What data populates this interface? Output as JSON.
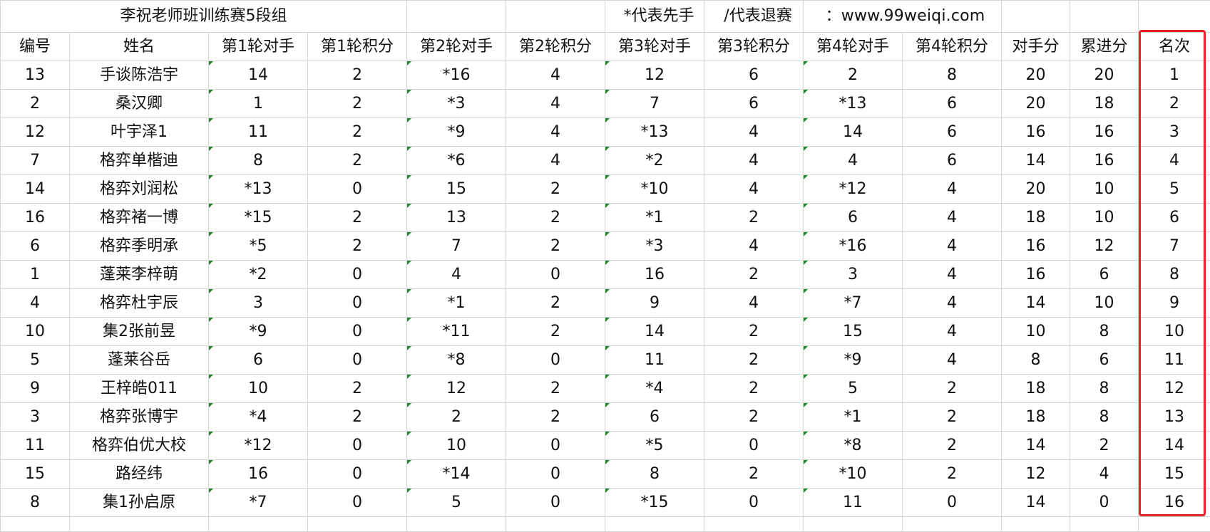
{
  "header": {
    "title": "李祝老师班训练赛5段组",
    "note_first_move": "*代表先手",
    "note_withdraw": "/代表退赛",
    "site": "：www.99weiqi.com"
  },
  "columns": [
    "编号",
    "姓名",
    "第1轮对手",
    "第1轮积分",
    "第2轮对手",
    "第2轮积分",
    "第3轮对手",
    "第3轮积分",
    "第4轮对手",
    "第4轮积分",
    "对手分",
    "累进分",
    "名次"
  ],
  "rows": [
    [
      "13",
      "手谈陈浩宇",
      "14",
      "2",
      "*16",
      "4",
      "12",
      "6",
      "2",
      "8",
      "20",
      "20",
      "1"
    ],
    [
      "2",
      "桑汉卿",
      "1",
      "2",
      "*3",
      "4",
      "7",
      "6",
      "*13",
      "6",
      "20",
      "18",
      "2"
    ],
    [
      "12",
      "叶宇泽1",
      "11",
      "2",
      "*9",
      "4",
      "*13",
      "4",
      "14",
      "6",
      "16",
      "16",
      "3"
    ],
    [
      "7",
      "格弈单楷迪",
      "8",
      "2",
      "*6",
      "4",
      "*2",
      "4",
      "4",
      "6",
      "14",
      "16",
      "4"
    ],
    [
      "14",
      "格弈刘润松",
      "*13",
      "0",
      "15",
      "2",
      "*10",
      "4",
      "*12",
      "4",
      "20",
      "10",
      "5"
    ],
    [
      "16",
      "格弈褚一博",
      "*15",
      "2",
      "13",
      "2",
      "*1",
      "2",
      "6",
      "4",
      "18",
      "10",
      "6"
    ],
    [
      "6",
      "格弈季明承",
      "*5",
      "2",
      "7",
      "2",
      "*3",
      "4",
      "*16",
      "4",
      "16",
      "12",
      "7"
    ],
    [
      "1",
      "蓬莱李梓萌",
      "*2",
      "0",
      "4",
      "0",
      "16",
      "2",
      "3",
      "4",
      "16",
      "6",
      "8"
    ],
    [
      "4",
      "格弈杜宇辰",
      "3",
      "0",
      "*1",
      "2",
      "9",
      "4",
      "*7",
      "4",
      "14",
      "10",
      "9"
    ],
    [
      "10",
      "集2张前昱",
      "*9",
      "0",
      "*11",
      "2",
      "14",
      "2",
      "15",
      "4",
      "10",
      "8",
      "10"
    ],
    [
      "5",
      "蓬莱谷岳",
      "6",
      "0",
      "*8",
      "0",
      "11",
      "2",
      "*9",
      "4",
      "8",
      "6",
      "11"
    ],
    [
      "9",
      "王梓皓011",
      "10",
      "2",
      "12",
      "2",
      "*4",
      "2",
      "5",
      "2",
      "18",
      "8",
      "12"
    ],
    [
      "3",
      "格弈张博宇",
      "*4",
      "2",
      "2",
      "2",
      "6",
      "2",
      "*1",
      "2",
      "18",
      "8",
      "13"
    ],
    [
      "11",
      "格弈伯优大校",
      "*12",
      "0",
      "10",
      "0",
      "*5",
      "0",
      "*8",
      "2",
      "14",
      "2",
      "14"
    ],
    [
      "15",
      "路经纬",
      "16",
      "0",
      "*14",
      "0",
      "8",
      "2",
      "*10",
      "2",
      "12",
      "4",
      "15"
    ],
    [
      "8",
      "集1孙启原",
      "*7",
      "0",
      "5",
      "0",
      "*15",
      "0",
      "11",
      "0",
      "14",
      "0",
      "16"
    ]
  ],
  "colors": {
    "gridline": "#d4d4d4",
    "highlight_box": "#e8232a",
    "cell_marker": "#1f8a2b"
  }
}
